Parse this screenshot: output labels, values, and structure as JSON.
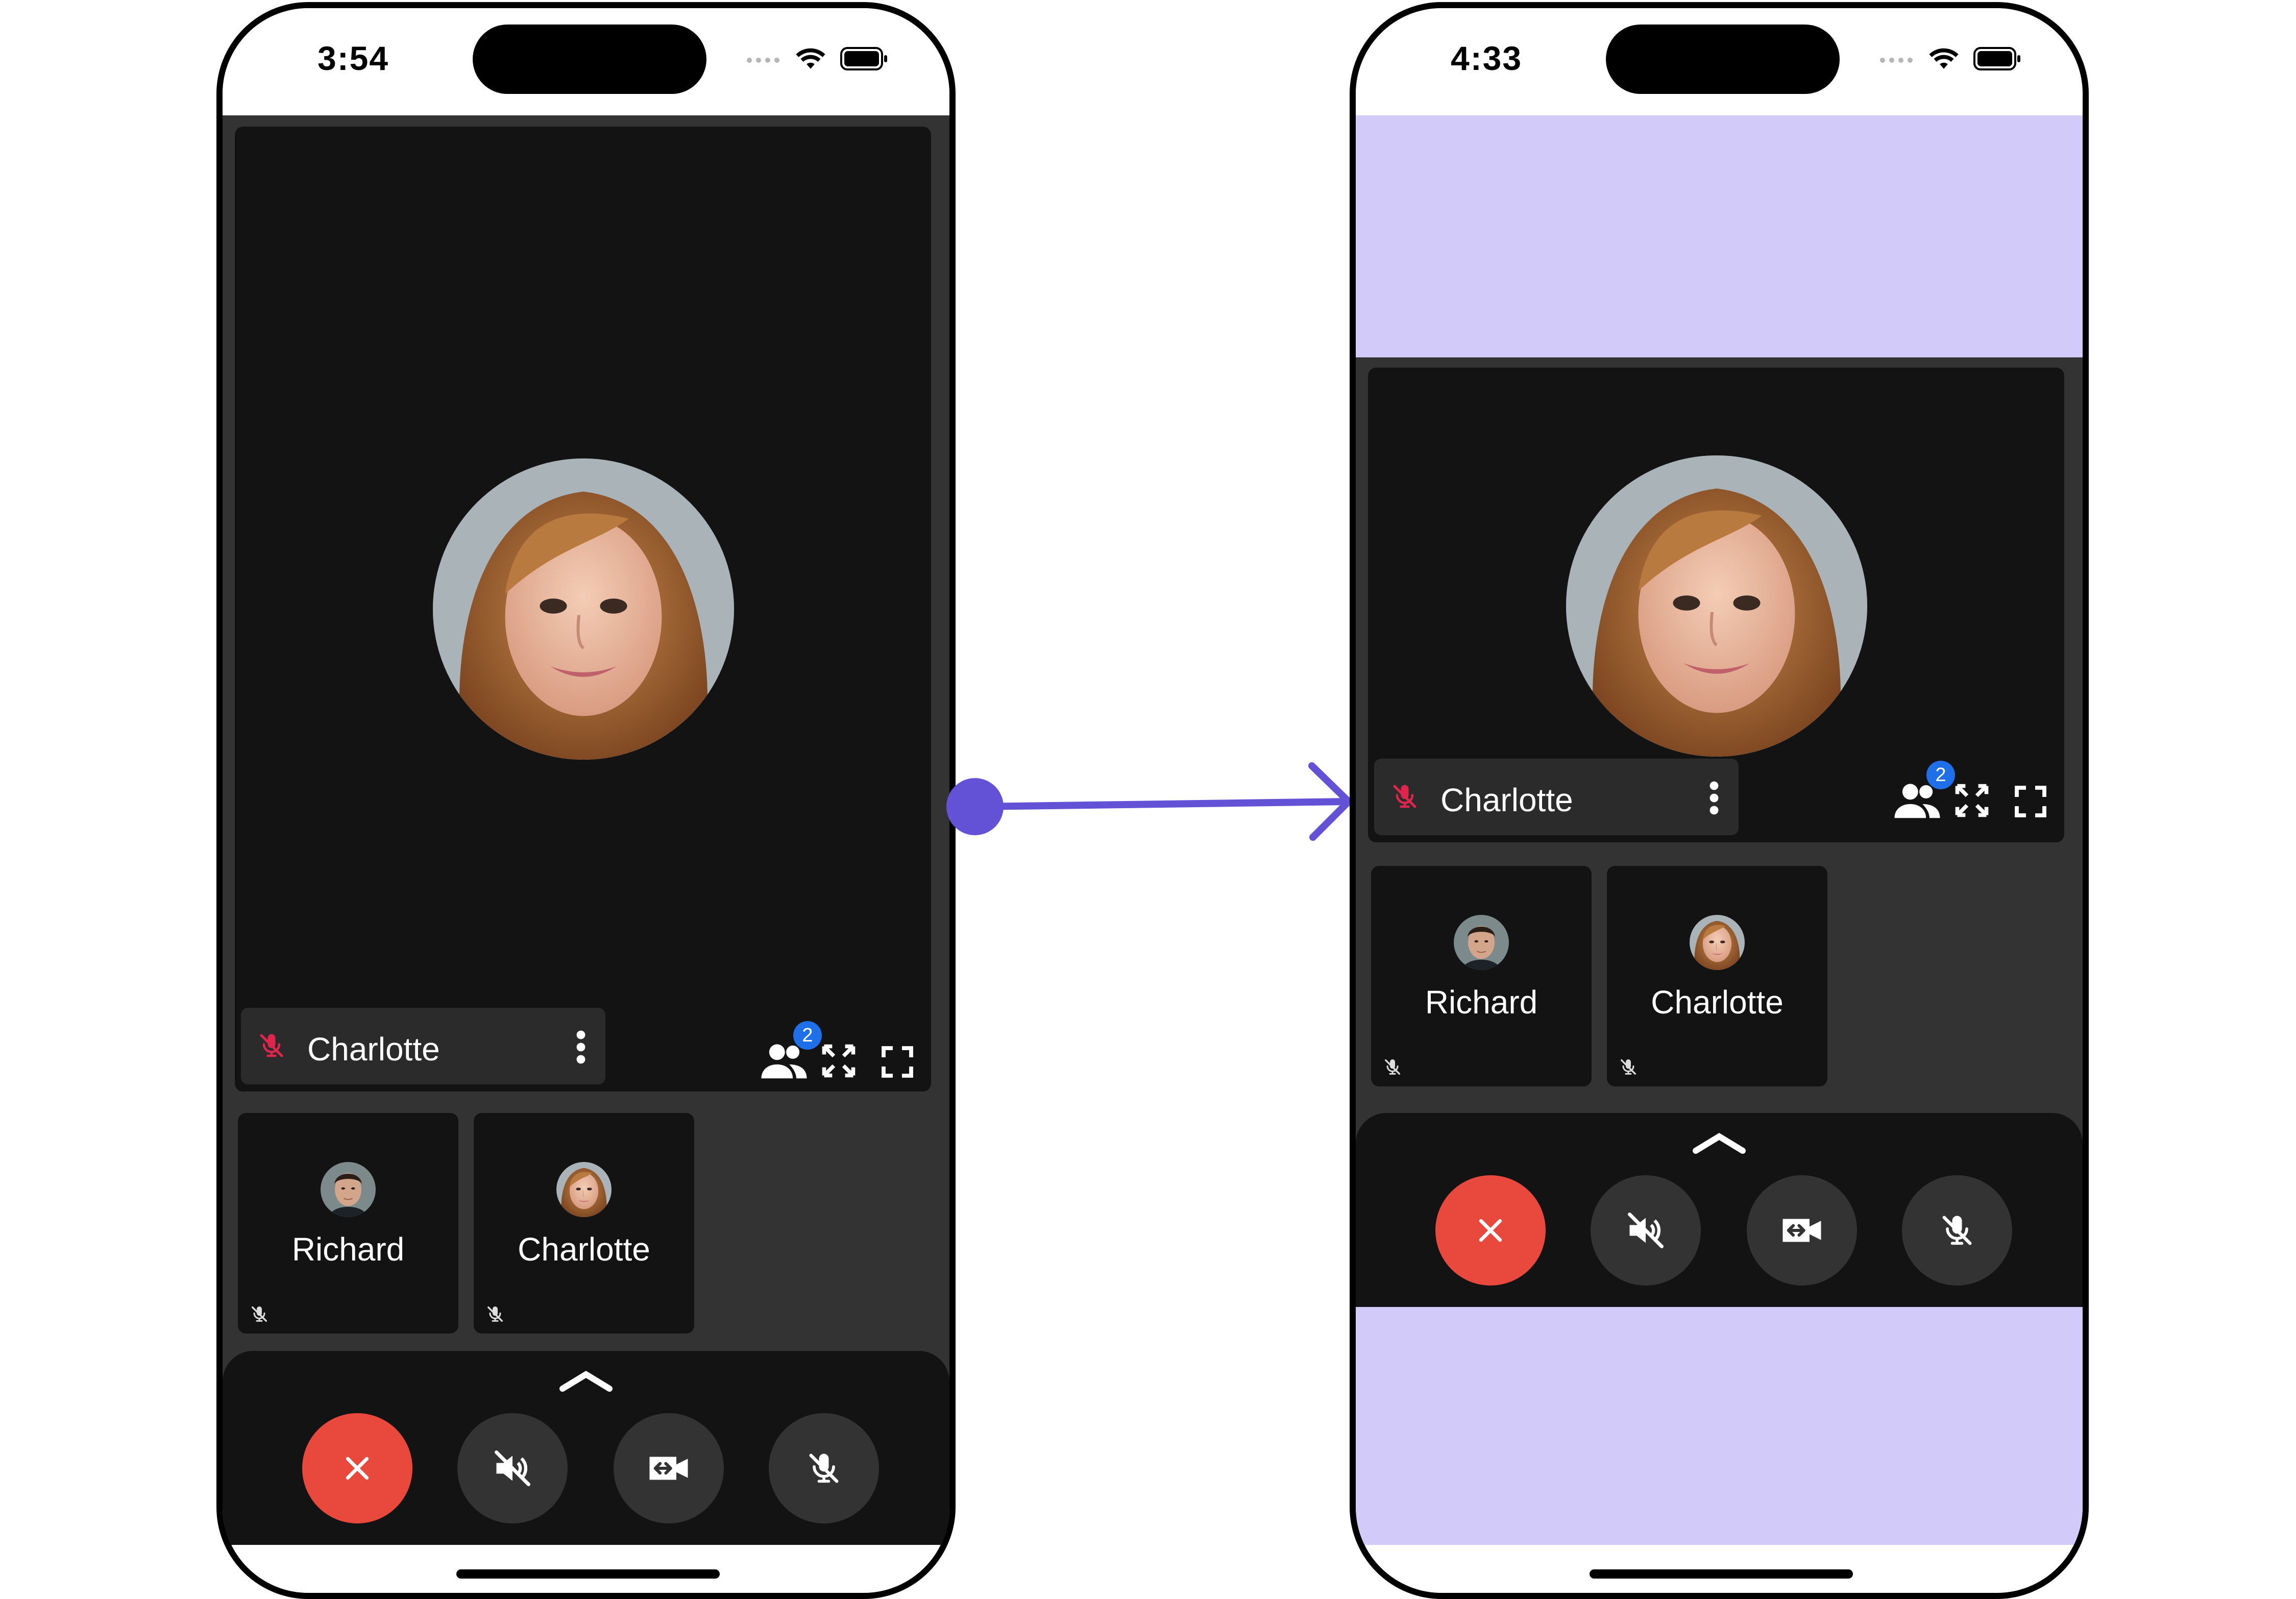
{
  "left_phone": {
    "status": {
      "time": "3:54"
    },
    "main_tile": {
      "participant_name": "Charlotte",
      "badge_count": "2"
    },
    "thumbnails": [
      {
        "name": "Richard"
      },
      {
        "name": "Charlotte"
      }
    ]
  },
  "right_phone": {
    "status": {
      "time": "4:33"
    },
    "main_tile": {
      "participant_name": "Charlotte",
      "badge_count": "2"
    },
    "thumbnails": [
      {
        "name": "Richard"
      },
      {
        "name": "Charlotte"
      }
    ]
  },
  "colors": {
    "accent": "#6352d6",
    "background_highlight": "#d2caf8",
    "end_call": "#e9493d",
    "badge": "#1e6fe8",
    "muted_mic": "#e0254d"
  },
  "icons": {
    "end_call": "close-icon",
    "speaker": "speaker-muted-icon",
    "camera": "switch-camera-icon",
    "mic": "mic-muted-icon",
    "participants": "participants-icon",
    "expand": "expand-icon",
    "fullscreen": "fullscreen-icon",
    "more": "kebab-menu-icon",
    "toggle": "chevron-up-icon"
  }
}
